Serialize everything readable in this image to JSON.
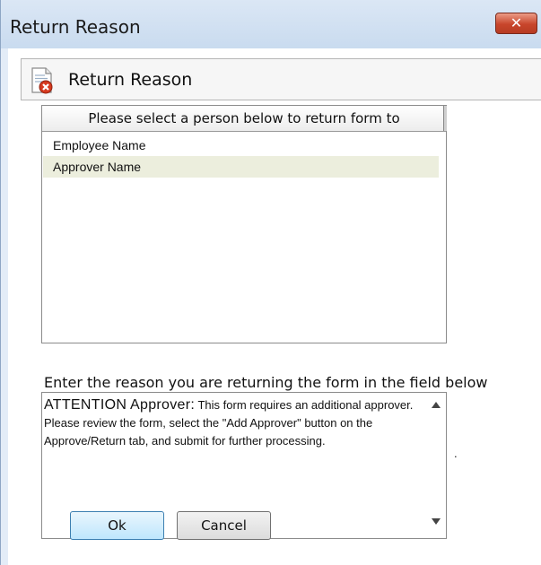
{
  "window": {
    "title": "Return Reason",
    "close_label": "✕"
  },
  "header": {
    "title": "Return Reason",
    "icon": "document-error-icon"
  },
  "person_list": {
    "column_header": "Please select a person below to return form to",
    "items": [
      {
        "label": "Employee Name",
        "selected": false
      },
      {
        "label": "Approver Name",
        "selected": true
      }
    ]
  },
  "reason": {
    "label": "Enter the reason you are returning the form in the field below",
    "text_lead": "ATTENTION Approver:",
    "text_body": "  This form requires an additional approver.  Please review the form, select the \"Add Approver\" button on the Approve/Return tab, and submit for further processing.",
    "trailing_mark": "."
  },
  "buttons": {
    "ok_label": "Ok",
    "cancel_label": "Cancel"
  },
  "colors": {
    "window_frame": "#c9dbef",
    "selected_row": "#eceedd",
    "close_button": "#c8452b",
    "ok_button": "#bee6fd"
  }
}
